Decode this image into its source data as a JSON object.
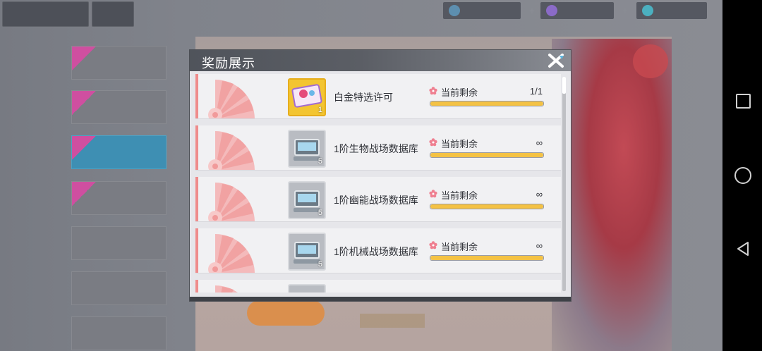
{
  "modal": {
    "title": "奖励展示"
  },
  "rewards": [
    {
      "name": "白金特选许可",
      "count": "1",
      "remain_label": "当前剩余",
      "remain_value": "1/1",
      "progress": 1.0,
      "box": "gold"
    },
    {
      "name": "1阶生物战场数据库",
      "count": "5",
      "remain_label": "当前剩余",
      "remain_value": "∞",
      "progress": 1.0,
      "box": "gray"
    },
    {
      "name": "1阶幽能战场数据库",
      "count": "5",
      "remain_label": "当前剩余",
      "remain_value": "∞",
      "progress": 1.0,
      "box": "gray"
    },
    {
      "name": "1阶机械战场数据库",
      "count": "5",
      "remain_label": "当前剩余",
      "remain_value": "∞",
      "progress": 1.0,
      "box": "gray"
    }
  ],
  "colors": {
    "accent_pink": "#ef8b8b",
    "progress_fill": "#f4c244",
    "header_dark": "#50545b",
    "gold_box": "#f3c531"
  },
  "icons": {
    "close": "close-x-icon",
    "remain": "sakura-icon",
    "fan": "fan-emblem-icon"
  }
}
